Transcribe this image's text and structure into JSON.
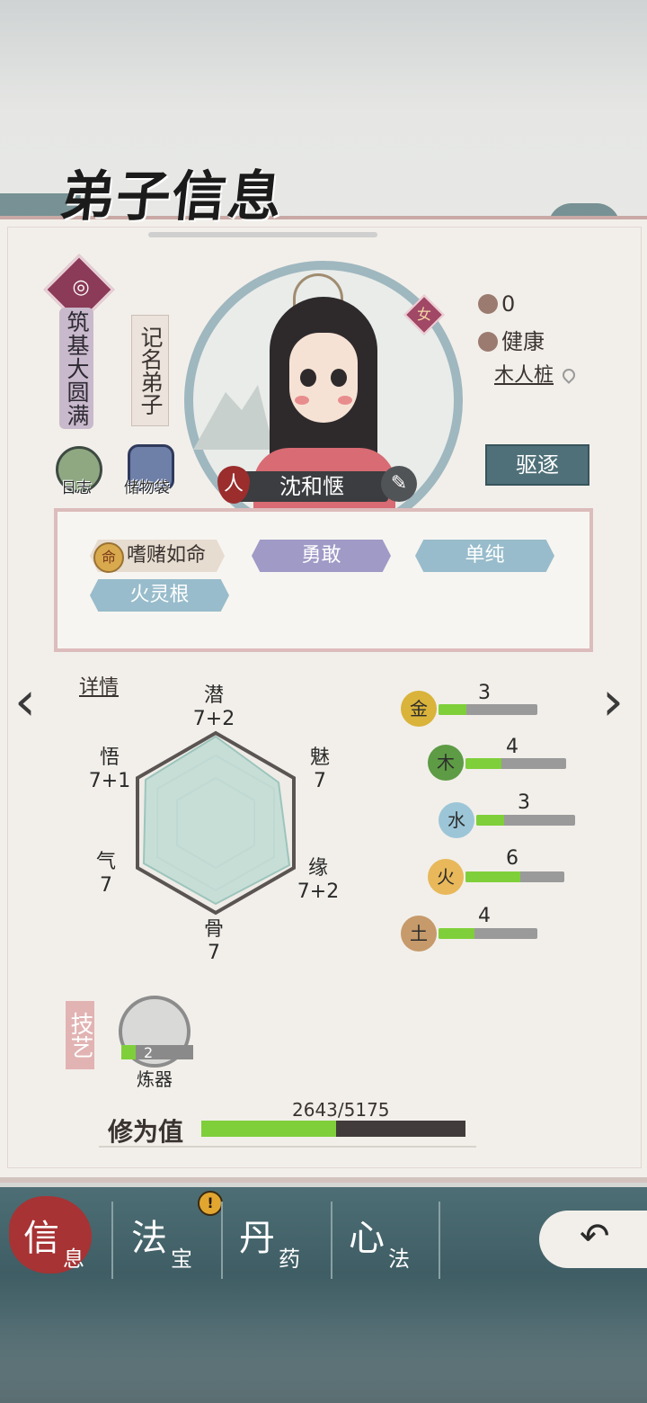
{
  "page_title": "弟子信息",
  "realm": "筑基大圆满",
  "rank": "记名弟子",
  "log_label": "日志",
  "bag_label": "储物袋",
  "gender": "女",
  "race": "人",
  "name": "沈和惬",
  "status": {
    "count": "0",
    "health": "健康",
    "location": "木人桩"
  },
  "expel_label": "驱逐",
  "traits": [
    "嗜赌如命",
    "勇敢",
    "单纯",
    "火灵根"
  ],
  "fate_icon_char": "命",
  "detail_label": "详情",
  "attributes": [
    {
      "name": "潜",
      "value": "7+2"
    },
    {
      "name": "魅",
      "value": "7"
    },
    {
      "name": "缘",
      "value": "7+2"
    },
    {
      "name": "骨",
      "value": "7"
    },
    {
      "name": "气",
      "value": "7"
    },
    {
      "name": "悟",
      "value": "7+1"
    }
  ],
  "elements": [
    {
      "name": "金",
      "value": "3",
      "fraction": 0.28,
      "color": "#d9b33a"
    },
    {
      "name": "木",
      "value": "4",
      "fraction": 0.36,
      "color": "#5d9b45"
    },
    {
      "name": "水",
      "value": "3",
      "fraction": 0.28,
      "color": "#9cc6d8"
    },
    {
      "name": "火",
      "value": "6",
      "fraction": 0.55,
      "color": "#e8b85a"
    },
    {
      "name": "土",
      "value": "4",
      "fraction": 0.36,
      "color": "#c69a6a"
    }
  ],
  "skills_label": "技艺",
  "skill": {
    "name": "炼器",
    "level": "2"
  },
  "cultivation": {
    "label": "修为值",
    "text": "2643/5175",
    "fraction": 0.51
  },
  "nav": [
    {
      "big": "信",
      "small": "息",
      "active": true
    },
    {
      "big": "法",
      "small": "宝",
      "alert": "!"
    },
    {
      "big": "丹",
      "small": "药"
    },
    {
      "big": "心",
      "small": "法"
    }
  ],
  "colors": {
    "accent": "#a73334",
    "teal": "#4f7078",
    "progress": "#7fcf3a"
  }
}
